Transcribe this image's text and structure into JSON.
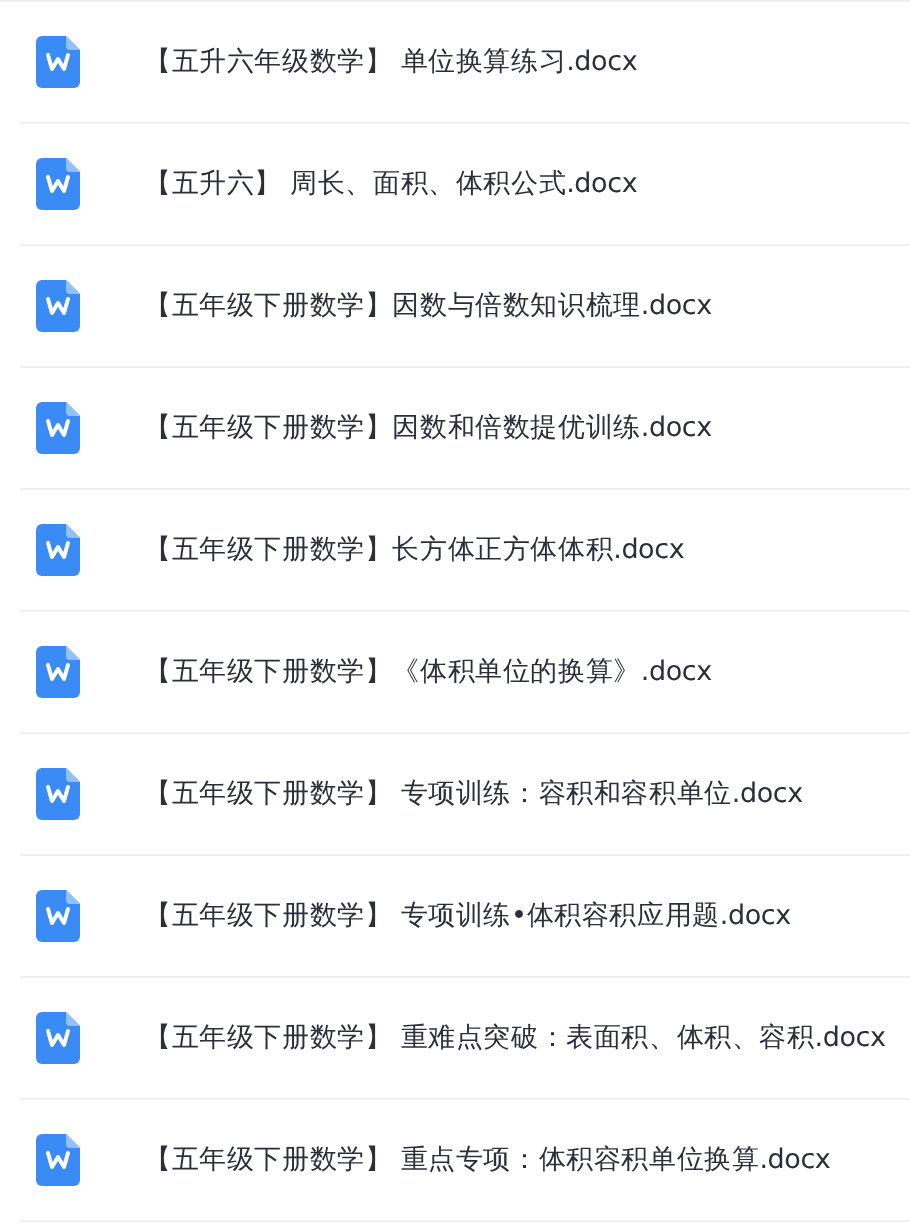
{
  "files": [
    {
      "name": "【五升六年级数学】 单位换算练习.docx"
    },
    {
      "name": "【五升六】 周长、面积、体积公式.docx"
    },
    {
      "name": "【五年级下册数学】因数与倍数知识梳理.docx"
    },
    {
      "name": "【五年级下册数学】因数和倍数提优训练.docx"
    },
    {
      "name": "【五年级下册数学】长方体正方体体积.docx"
    },
    {
      "name": "【五年级下册数学】《体积单位的换算》.docx"
    },
    {
      "name": "【五年级下册数学】 专项训练：容积和容积单位.docx"
    },
    {
      "name": "【五年级下册数学】 专项训练•体积容积应用题.docx"
    },
    {
      "name": "【五年级下册数学】 重难点突破：表面积、体积、容积.docx"
    },
    {
      "name": "【五年级下册数学】 重点专项：体积容积单位换算.docx"
    }
  ]
}
